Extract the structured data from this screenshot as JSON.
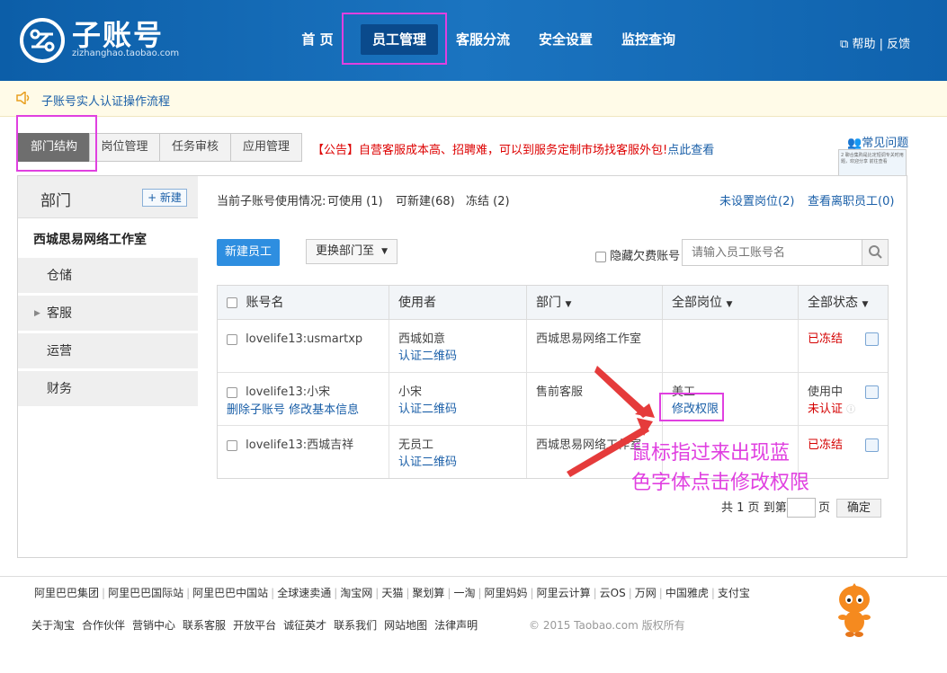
{
  "header": {
    "logo_text": "子账号",
    "logo_sub": "zizhanghao.taobao.com",
    "nav": [
      "首 页",
      "员工管理",
      "客服分流",
      "安全设置",
      "监控查询"
    ],
    "help": "帮助",
    "feedback": "反馈"
  },
  "notice": {
    "text": "子账号实人认证操作流程"
  },
  "tabs": [
    "部门结构",
    "岗位管理",
    "任务审核",
    "应用管理"
  ],
  "announcement": {
    "tag": "【公告】",
    "text": "自营客服成本高、招聘难，可以到服务定制市场找客服外包!",
    "link": "点此查看"
  },
  "faq": {
    "label": "常见问题",
    "thumb_text": "2 聊合集购是比定短调专关时用题，欢迎分享 前往查看"
  },
  "sidebar": {
    "title": "部门",
    "new_label": "+ 新建",
    "root": "西城思易网络工作室",
    "items": [
      "仓储",
      "客服",
      "运营",
      "财务"
    ]
  },
  "usage": {
    "label": "当前子账号使用情况:",
    "available": "可使用 (1)",
    "creatable": "可新建(68)",
    "frozen": "冻结 (2)",
    "unset_link": "未设置岗位(2)",
    "resigned_link": "查看离职员工(0)"
  },
  "toolbar": {
    "new_employee": "新建员工",
    "move_dept": "更换部门至",
    "hide_label": "隐藏欠费账号",
    "search_placeholder": "请输入员工账号名"
  },
  "table": {
    "headers": [
      "账号名",
      "使用者",
      "部门",
      "全部岗位",
      "全部状态"
    ],
    "rows": [
      {
        "account": "lovelife13:usmartxp",
        "actions": "",
        "user": "西城如意",
        "user_link": "认证二维码",
        "dept": "西城思易网络工作室",
        "role": "",
        "role_link": "",
        "status": "已冻结",
        "status2": ""
      },
      {
        "account": "lovelife13:小宋",
        "actions": "删除子账号 修改基本信息",
        "user": "小宋",
        "user_link": "认证二维码",
        "dept": "售前客服",
        "role": "美工",
        "role_link": "修改权限",
        "status": "使用中",
        "status2": "未认证"
      },
      {
        "account": "lovelife13:西城吉祥",
        "actions": "",
        "user": "无员工",
        "user_link": "认证二维码",
        "dept": "西城思易网络工作室",
        "role": "",
        "role_link": "",
        "status": "已冻结",
        "status2": ""
      }
    ]
  },
  "pager": {
    "total": "共 1 页",
    "goto": "到第",
    "page_unit": "页",
    "confirm": "确定"
  },
  "annotation": {
    "line1": "鼠标指过来出现蓝",
    "line2": "色字体点击修改权限"
  },
  "footer": {
    "links1": [
      "阿里巴巴集团",
      "阿里巴巴国际站",
      "阿里巴巴中国站",
      "全球速卖通",
      "淘宝网",
      "天猫",
      "聚划算",
      "一淘",
      "阿里妈妈",
      "阿里云计算",
      "云OS",
      "万网",
      "中国雅虎",
      "支付宝"
    ],
    "links2": [
      "关于淘宝",
      "合作伙伴",
      "营销中心",
      "联系客服",
      "开放平台",
      "诚征英才",
      "联系我们",
      "网站地图",
      "法律声明"
    ],
    "copyright": "© 2015 Taobao.com 版权所有"
  },
  "colors": {
    "brand_blue": "#1467b4",
    "link_blue": "#1a5fa8",
    "annotation": "#e040e0",
    "frozen_red": "#d40000"
  }
}
